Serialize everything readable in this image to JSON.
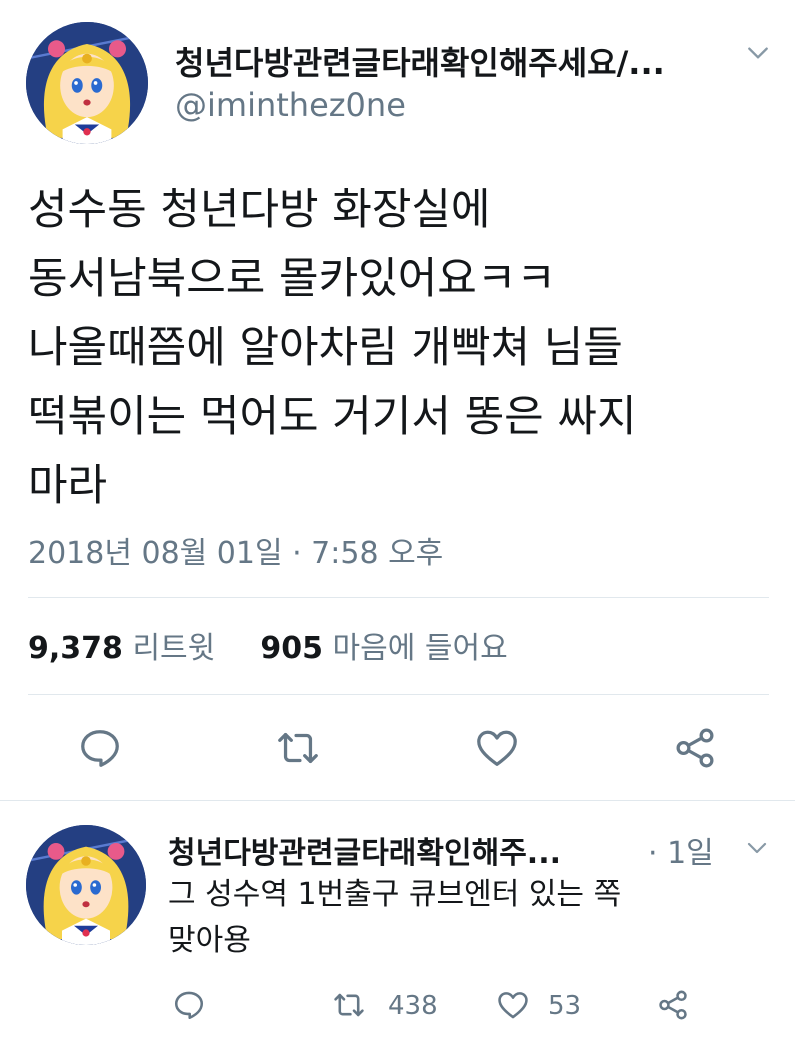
{
  "main_tweet": {
    "display_name": "청년다방관련글타래확인해주세요/...",
    "handle": "@iminthez0ne",
    "text_lines": [
      "성수동 청년다방 화장실에",
      "동서남북으로 몰카있어요ㅋㅋ",
      "나올때쯤에 알아차림 개빡쳐 님들",
      "떡볶이는 먹어도 거기서 똥은 싸지",
      "마라"
    ],
    "timestamp": "2018년 08월 01일 · 7:58 오후",
    "retweet_count": "9,378",
    "retweet_label": "리트윗",
    "like_count": "905",
    "like_label": "마음에 들어요"
  },
  "reply_tweet": {
    "display_name": "청년다방관련글타래확인해주...",
    "time": "· 1일",
    "text_lines": [
      "그 성수역 1번출구 큐브엔터 있는 쪽",
      "맞아용"
    ],
    "retweet_count": "438",
    "like_count": "53"
  },
  "icons": {
    "reply": "reply-icon",
    "retweet": "retweet-icon",
    "like": "heart-icon",
    "share": "share-icon",
    "menu": "chevron-down-icon"
  },
  "colors": {
    "text_primary": "#14171a",
    "text_secondary": "#657786",
    "divider": "#e1e8ed"
  }
}
